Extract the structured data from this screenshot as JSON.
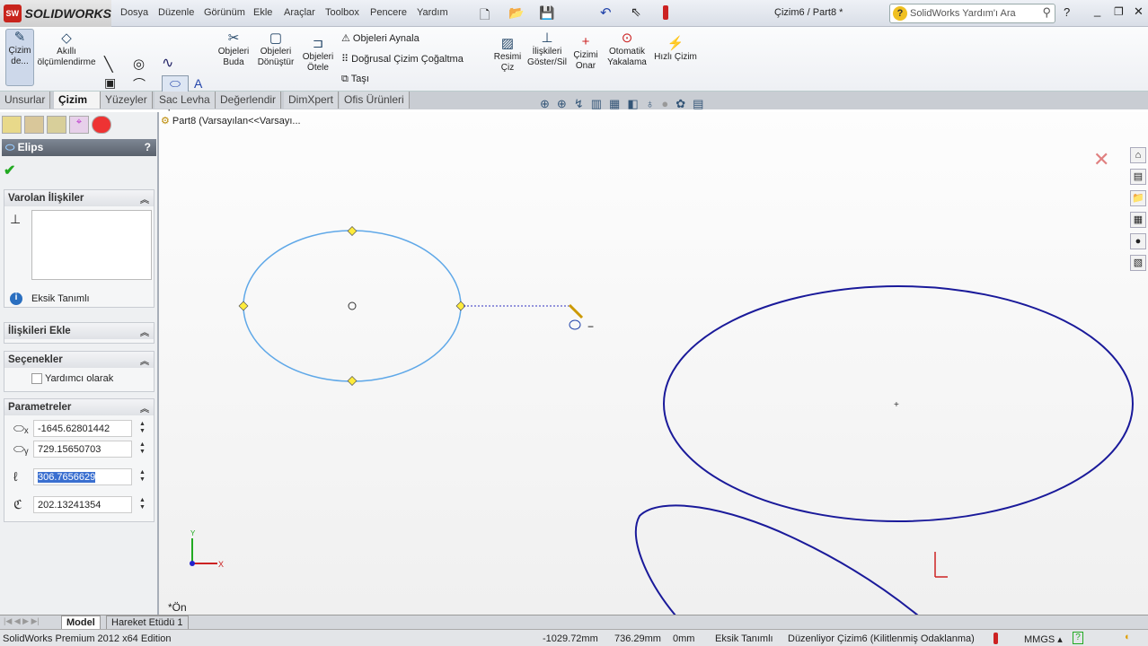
{
  "app": {
    "brand": "SOLIDWORKS",
    "doc_title": "Çizim6 / Part8 *"
  },
  "menu": [
    "Dosya",
    "Düzenle",
    "Görünüm",
    "Ekle",
    "Araçlar",
    "Toolbox",
    "Pencere",
    "Yardım"
  ],
  "search": {
    "placeholder": "SolidWorks Yardım'ı Ara"
  },
  "ribbon": {
    "sketch": "Çizim de...",
    "smart_dim": "Akıllı ölçümlendirme",
    "trim": "Objeleri Buda",
    "convert": "Objeleri Dönüştür",
    "offset": "Objeleri Ötele",
    "mirror": "Objeleri Aynala",
    "linear_pattern": "Doğrusal Çizim Çoğaltma",
    "move": "Taşı",
    "sketch_picture": "Resimi Çiz",
    "relations": "İlişkileri Göster/Sil",
    "repair": "Çizimi Onar",
    "quick_snaps": "Otomatik Yakalama",
    "rapid_sketch": "Hızlı Çizim"
  },
  "tabs": [
    "Unsurlar",
    "Çizim",
    "Yüzeyler",
    "Sac Levha",
    "Değerlendir",
    "DimXpert",
    "Ofis Ürünleri"
  ],
  "tree": {
    "label": "Part8  (Varsayılan<<Varsayı..."
  },
  "panel": {
    "title": "Elips",
    "help": "?",
    "existing_relations": "Varolan İlişkiler",
    "status": "Eksik Tanımlı",
    "add_relations": "İlişkileri Ekle",
    "options": "Seçenekler",
    "construction": "Yardımcı olarak",
    "parameters": "Parametreler",
    "params": {
      "cx": "-1645.62801442",
      "cy": "729.15650703",
      "major": "306.7656629",
      "minor": "202.13241354"
    }
  },
  "view": {
    "orientation": "*Ön",
    "axis_x": "X",
    "axis_y": "Y"
  },
  "bottom_tabs": [
    "Model",
    "Hareket Etüdü 1"
  ],
  "status": {
    "edition": "SolidWorks Premium 2012 x64 Edition",
    "x": "-1029.72mm",
    "y": "736.29mm",
    "z": "0mm",
    "def": "Eksik Tanımlı",
    "editing": "Düzenliyor Çizim6 (Kilitlenmiş Odaklanma)",
    "units": "MMGS"
  },
  "colors": {
    "selected_sketch": "#5fa8e8",
    "sketch": "#1a1a9a"
  }
}
